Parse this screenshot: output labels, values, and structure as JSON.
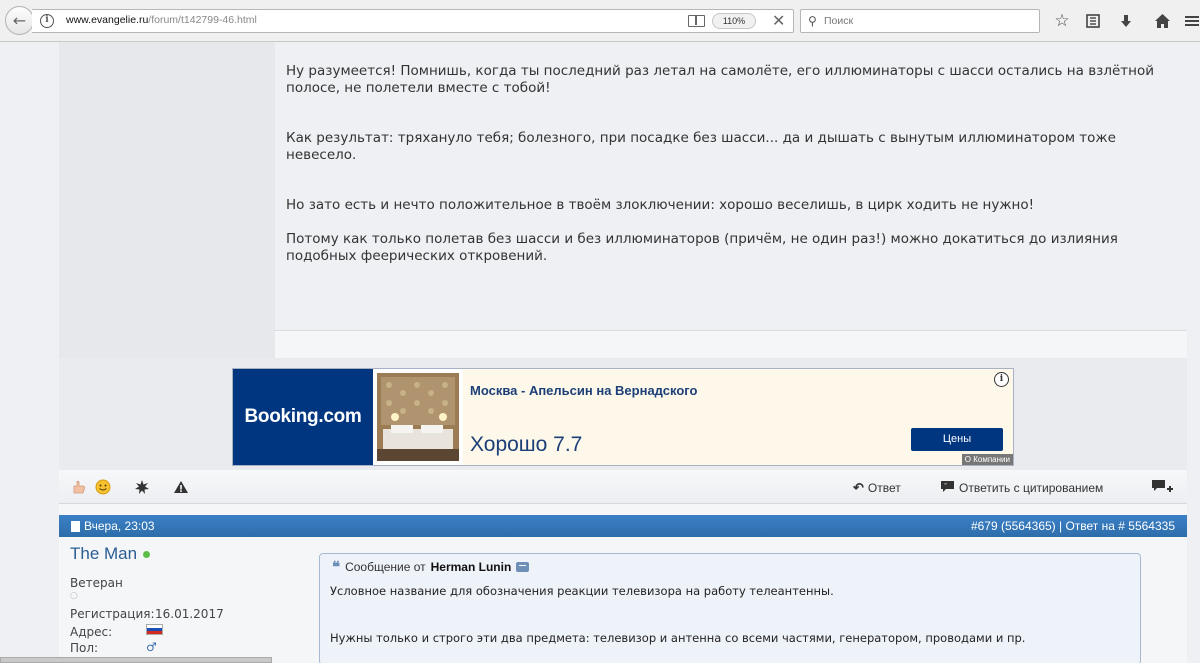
{
  "browser": {
    "url_domain": "www.evangelie.ru",
    "url_path": "/forum/t142799-46.html",
    "zoom": "110%",
    "search_placeholder": "Поиск"
  },
  "post1": {
    "paragraphs": [
      "Ну разумеется! Помнишь, когда ты последний раз летал на самолёте, его иллюминаторы с шасси остались на взлётной полосе, не полетели вместе с тобой!",
      "Как результат: тряхануло тебя; болезного, при посадке без шасси... да и дышать с вынутым иллюминатором тоже невесело.",
      "Но зато есть и нечто положительное в твоём злоключении: хорошо веселишь, в цирк ходить не нужно!",
      "Потому как только полетав без шасси и без иллюминаторов (причём, не один раз!) можно докатиться до излияния подобных феерических откровений."
    ]
  },
  "ad": {
    "logo": "Booking.com",
    "title": "Москва - Апельсин на Вернадского",
    "rating": "Хорошо 7.7",
    "button": "Цены",
    "company": "О Компании",
    "brand_color": "#003580"
  },
  "actions": {
    "reply": "Ответ",
    "reply_quote": "Ответить с цитированием"
  },
  "post2": {
    "date": "Вчера, 23:03",
    "number": "#679 (5564365) | Ответ на # 5564335",
    "username": "The Man",
    "rank": "Ветеран",
    "reg_label": "Регистрация:",
    "reg_value": "16.01.2017",
    "addr_label": "Адрес:",
    "sex_label": "Пол:",
    "quote_prefix": "Сообщение от",
    "quote_author": "Herman Lunin",
    "quote_lines": [
      "Условное название для обозначения реакции телевизора на работу телеантенны.",
      "Нужны только и строго эти два предмета: телевизор и антенна со всеми частями, генератором, проводами и пр."
    ],
    "header_color": "#3b80c6",
    "username_color": "#2a5d93"
  }
}
